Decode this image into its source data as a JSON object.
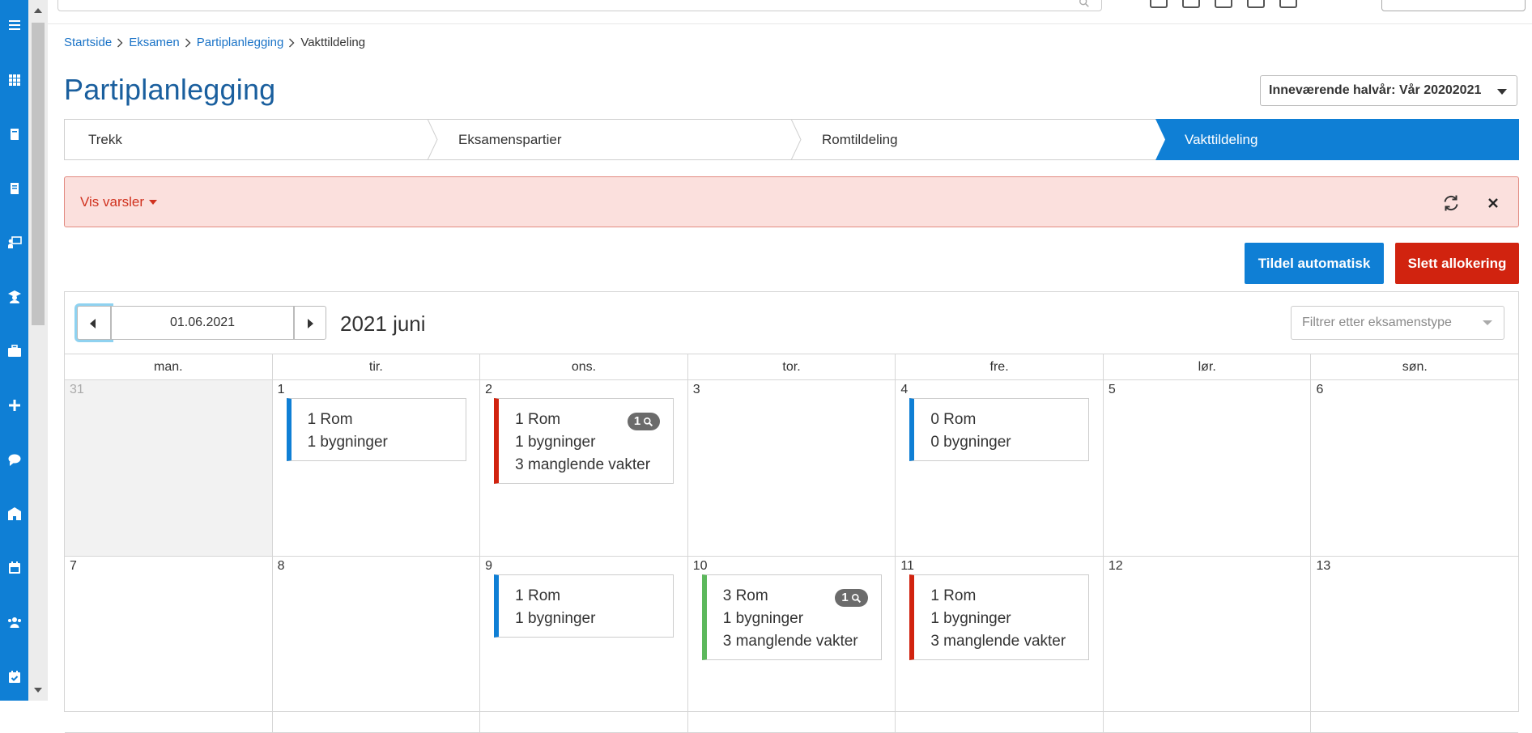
{
  "colors": {
    "brand": "#0f7fd5",
    "danger": "#d1230f",
    "success": "#5cb85c",
    "alert_bg": "#fbe0dd",
    "title": "#1a5f9e"
  },
  "nav_rail": {
    "items": [
      {
        "icon": "menu-icon"
      },
      {
        "icon": "apps-grid-icon"
      },
      {
        "icon": "book-icon"
      },
      {
        "icon": "book-alt-icon"
      },
      {
        "icon": "teacher-board-icon"
      },
      {
        "icon": "graduate-icon"
      },
      {
        "icon": "briefcase-icon"
      },
      {
        "icon": "plus-icon"
      },
      {
        "icon": "chat-icon"
      },
      {
        "icon": "building-icon"
      },
      {
        "icon": "calendar-icon"
      },
      {
        "icon": "users-icon"
      },
      {
        "icon": "calendar-check-icon"
      }
    ]
  },
  "breadcrumb": {
    "items": [
      "Startside",
      "Eksamen",
      "Partiplanlegging"
    ],
    "current": "Vakttildeling"
  },
  "page": {
    "title": "Partiplanlegging"
  },
  "semester": {
    "label": "Inneværende halvår: Vår 20202021"
  },
  "steps": [
    {
      "label": "Trekk",
      "active": false
    },
    {
      "label": "Eksamenspartier",
      "active": false
    },
    {
      "label": "Romtildeling",
      "active": false
    },
    {
      "label": "Vakttildeling",
      "active": true
    }
  ],
  "alert": {
    "toggle_label": "Vis varsler"
  },
  "actions": {
    "auto_assign_label": "Tildel automatisk",
    "delete_allocation_label": "Slett allokering"
  },
  "calendar": {
    "date_value": "01.06.2021",
    "month_title": "2021 juni",
    "filter_placeholder": "Filtrer etter eksamenstype",
    "weekdays": [
      "man.",
      "tir.",
      "ons.",
      "tor.",
      "fre.",
      "lør.",
      "søn."
    ],
    "weeks": [
      [
        {
          "day": "31",
          "other": true
        },
        {
          "day": "1",
          "event": {
            "rooms": "1 Rom",
            "buildings": "1 bygninger",
            "color": "#0f7fd5"
          }
        },
        {
          "day": "2",
          "event": {
            "rooms": "1 Rom",
            "buildings": "1 bygninger",
            "missing": "3 manglende vakter",
            "badge": "1",
            "color": "#d1230f"
          }
        },
        {
          "day": "3"
        },
        {
          "day": "4",
          "event": {
            "rooms": "0 Rom",
            "buildings": "0 bygninger",
            "color": "#0f7fd5"
          }
        },
        {
          "day": "5"
        },
        {
          "day": "6"
        }
      ],
      [
        {
          "day": "7"
        },
        {
          "day": "8"
        },
        {
          "day": "9",
          "event": {
            "rooms": "1 Rom",
            "buildings": "1 bygninger",
            "color": "#0f7fd5"
          }
        },
        {
          "day": "10",
          "event": {
            "rooms": "3 Rom",
            "buildings": "1 bygninger",
            "missing": "3 manglende vakter",
            "badge": "1",
            "color": "#5cb85c"
          }
        },
        {
          "day": "11",
          "event": {
            "rooms": "1 Rom",
            "buildings": "1 bygninger",
            "missing": "3 manglende vakter",
            "color": "#d1230f"
          }
        },
        {
          "day": "12"
        },
        {
          "day": "13"
        }
      ]
    ]
  }
}
